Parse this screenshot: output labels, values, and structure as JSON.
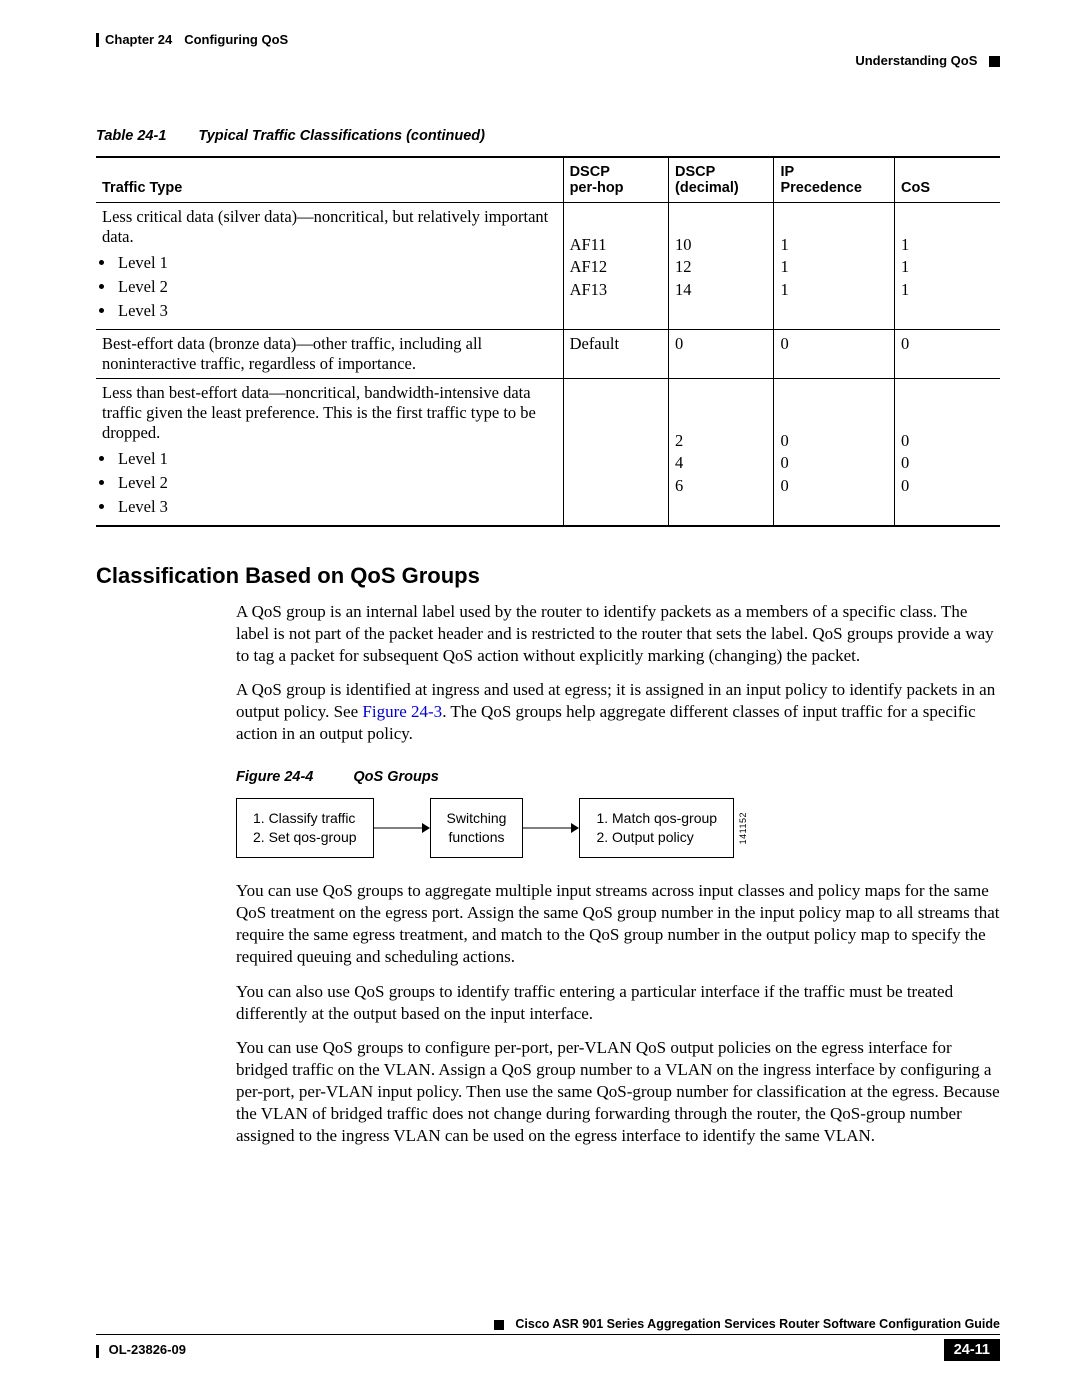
{
  "header": {
    "chapter": "Chapter 24",
    "title": "Configuring QoS",
    "section": "Understanding QoS"
  },
  "table": {
    "caption_label": "Table 24-1",
    "caption_text": "Typical Traffic Classifications (continued)",
    "headers": {
      "traffic": "Traffic Type",
      "dscp_ph1": "DSCP",
      "dscp_ph2": "per-hop",
      "dscp_dec1": "DSCP",
      "dscp_dec2": "(decimal)",
      "ip1": "IP",
      "ip2": "Precedence",
      "cos": "CoS"
    },
    "row_silver": {
      "desc": "Less critical data (silver data)—noncritical, but relatively important data.",
      "l1": "Level 1",
      "l2": "Level 2",
      "l3": "Level 3",
      "ph": {
        "a": "AF11",
        "b": "AF12",
        "c": "AF13"
      },
      "dec": {
        "a": "10",
        "b": "12",
        "c": "14"
      },
      "ip": {
        "a": "1",
        "b": "1",
        "c": "1"
      },
      "cos": {
        "a": "1",
        "b": "1",
        "c": "1"
      }
    },
    "row_bronze": {
      "desc": "Best-effort data (bronze data)—other traffic, including all noninteractive traffic, regardless of importance.",
      "ph": "Default",
      "dec": "0",
      "ip": "0",
      "cos": "0"
    },
    "row_ltbe": {
      "desc": "Less than best-effort data—noncritical, bandwidth-intensive data traffic given the least preference. This is the first traffic type to be dropped.",
      "l1": "Level 1",
      "l2": "Level 2",
      "l3": "Level 3",
      "dec": {
        "a": "2",
        "b": "4",
        "c": "6"
      },
      "ip": {
        "a": "0",
        "b": "0",
        "c": "0"
      },
      "cos": {
        "a": "0",
        "b": "0",
        "c": "0"
      }
    }
  },
  "section_heading": "Classification Based on QoS Groups",
  "paragraphs": {
    "p1": "A QoS group is an internal label used by the router to identify packets as a members of a specific class. The label is not part of the packet header and is restricted to the router that sets the label. QoS groups provide a way to tag a packet for subsequent QoS action without explicitly marking (changing) the packet.",
    "p2a": "A QoS group is identified at ingress and used at egress; it is assigned in an input policy to identify packets in an output policy. See ",
    "p2_link": "Figure 24-3",
    "p2b": ". The QoS groups help aggregate different classes of input traffic for a specific action in an output policy.",
    "p3": "You can use QoS groups to aggregate multiple input streams across input classes and policy maps for the same QoS treatment on the egress port. Assign the same QoS group number in the input policy map to all streams that require the same egress treatment, and match to the QoS group number in the output policy map to specify the required queuing and scheduling actions.",
    "p4": "You can also use QoS groups to identify traffic entering a particular interface if the traffic must be treated differently at the output based on the input interface.",
    "p5": "You can use QoS groups to configure per-port, per-VLAN QoS output policies on the egress interface for bridged traffic on the VLAN. Assign a QoS group number to a VLAN on the ingress interface by configuring a per-port, per-VLAN input policy. Then use the same QoS-group number for classification at the egress. Because the VLAN of bridged traffic does not change during forwarding through the router, the QoS-group number assigned to the ingress VLAN can be used on the egress interface to identify the same VLAN."
  },
  "figure": {
    "label": "Figure 24-4",
    "title": "QoS Groups",
    "box1_l1": "1. Classify traffic",
    "box1_l2": "2. Set qos-group",
    "box2_l1": "Switching",
    "box2_l2": "functions",
    "box3_l1": "1. Match qos-group",
    "box3_l2": "2. Output policy",
    "id": "141152"
  },
  "footer": {
    "book": "Cisco ASR 901 Series Aggregation Services Router Software Configuration Guide",
    "doc": "OL-23826-09",
    "page": "24-11"
  }
}
